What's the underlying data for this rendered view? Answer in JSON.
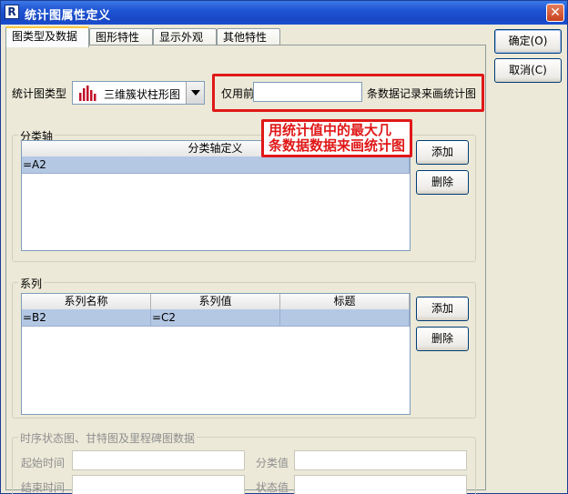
{
  "window": {
    "title": "统计图属性定义",
    "icon_letter": "R",
    "close_glyph": "✕"
  },
  "tabs": [
    {
      "label": "图类型及数据",
      "active": true
    },
    {
      "label": "图形特性",
      "active": false
    },
    {
      "label": "显示外观",
      "active": false
    },
    {
      "label": "其他特性",
      "active": false
    }
  ],
  "chart_type": {
    "label": "统计图类型",
    "selected": "三维簇状柱形图",
    "icon": "bar-chart-icon"
  },
  "only_use": {
    "prefix": "仅用前",
    "value": "",
    "suffix": "条数据记录来画统计图"
  },
  "callout": {
    "line1": "用统计值中的最大几",
    "line2": "条数据数据来画统计图"
  },
  "category_axis": {
    "legend": "分类轴",
    "column_header": "分类轴定义",
    "rows": [
      "=A2"
    ],
    "add_label": "添加",
    "delete_label": "删除"
  },
  "series": {
    "legend": "系列",
    "columns": [
      "系列名称",
      "系列值",
      "标题"
    ],
    "rows": [
      [
        "=B2",
        "=C2",
        ""
      ]
    ],
    "add_label": "添加",
    "delete_label": "删除"
  },
  "timeline": {
    "legend": "时序状态图、甘特图及里程碑图数据",
    "start_time_label": "起始时间",
    "end_time_label": "结束时间",
    "category_value_label": "分类值",
    "status_value_label": "状态值",
    "start_time_value": "",
    "end_time_value": "",
    "category_value": "",
    "status_value": ""
  },
  "dialog_buttons": {
    "ok_label": "确定(O)",
    "cancel_label": "取消(C)"
  },
  "colors": {
    "titlebar": "#1f54d3",
    "highlight": "#e01818",
    "selected_row": "#b4c8e4",
    "chart_icon_bars": "#c0102a"
  }
}
